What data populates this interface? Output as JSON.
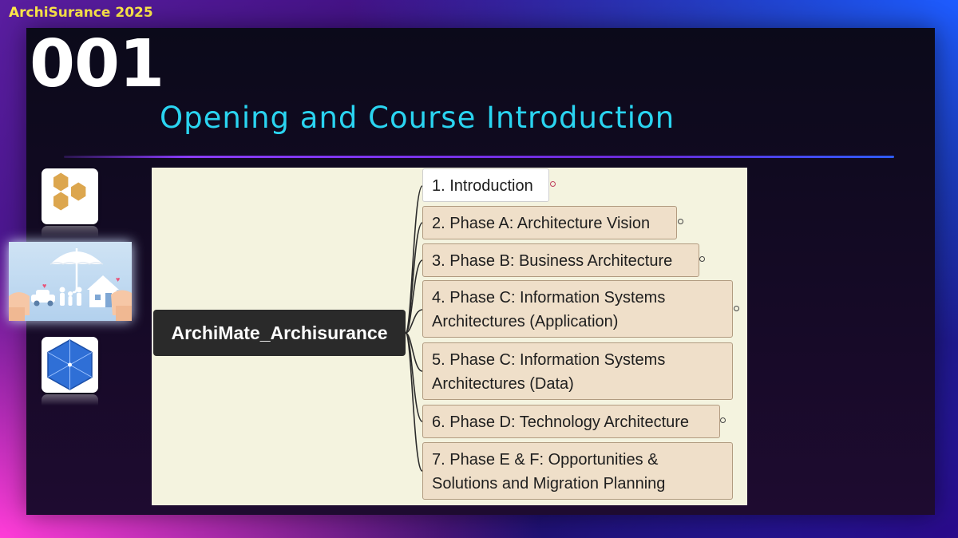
{
  "brand": "ArchiSurance 2025",
  "slide": {
    "number": "001",
    "title": "Opening and Course Introduction"
  },
  "icons": [
    "hexagon-cluster-icon",
    "family-umbrella-insurance-image",
    "blue-hexagon-icon"
  ],
  "mindmap": {
    "root": "ArchiMate_Archisurance",
    "nodes": [
      {
        "label": "1. Introduction",
        "selected": true
      },
      {
        "label": "2. Phase A: Architecture Vision"
      },
      {
        "label": "3. Phase B: Business Architecture"
      },
      {
        "label": "4. Phase C: Information Systems\nArchitectures (Application)"
      },
      {
        "label": "5. Phase C: Information Systems\nArchitectures (Data)"
      },
      {
        "label": "6. Phase D: Technology Architecture"
      },
      {
        "label": "7. Phase E & F: Opportunities &\nSolutions and Migration Planning"
      }
    ]
  },
  "colors": {
    "brand": "#ffe94a",
    "title": "#2ad4f0",
    "root_bg": "#2a2a2a",
    "node_bg": "#efdfc9",
    "map_bg": "#f4f3df"
  }
}
